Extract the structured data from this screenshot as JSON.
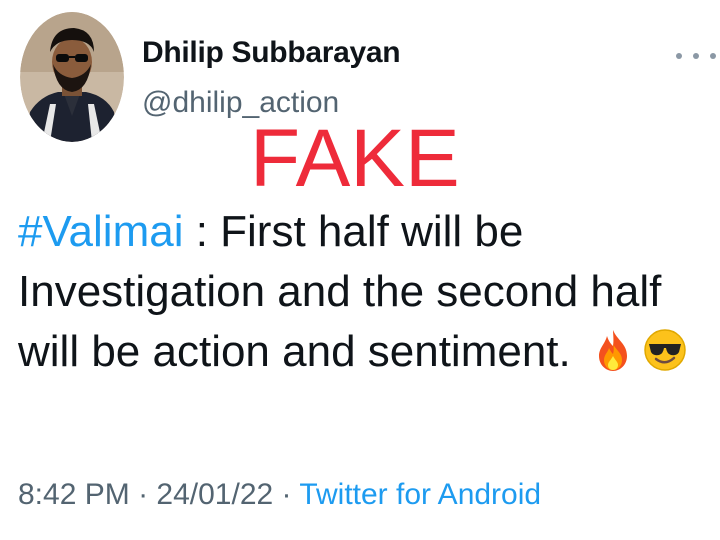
{
  "author": {
    "display_name": "Dhilip Subbarayan",
    "handle": "@dhilip_action"
  },
  "overlay": {
    "stamp_text": "FAKE",
    "stamp_color": "#ee2b3a"
  },
  "tweet": {
    "hashtag": "#Valimai",
    "line1_rest": " : First half will be",
    "line2": "Investigation and the second half",
    "line3": "will be action and sentiment. ",
    "emojis": [
      "fire-emoji",
      "smiling-face-with-sunglasses-emoji"
    ]
  },
  "meta": {
    "time": "8:42 PM",
    "separator1": " · ",
    "date": "24/01/22",
    "separator2": " · ",
    "source": "Twitter for Android"
  },
  "colors": {
    "link": "#1d9bf0",
    "secondary_text": "#536471",
    "primary_text": "#0f1419"
  }
}
